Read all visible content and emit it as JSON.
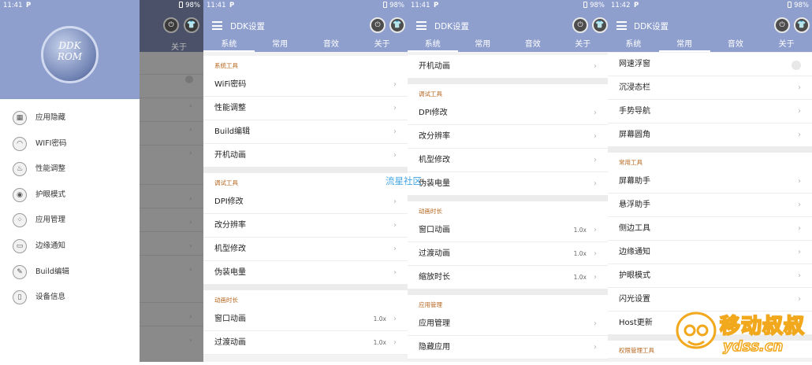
{
  "screens": [
    {
      "status": {
        "time": "11:41",
        "icon": "P",
        "battery": "98%"
      }
    },
    {
      "status": {
        "time": "11:41",
        "icon": "P",
        "battery": "98%"
      }
    },
    {
      "status": {
        "time": "11:41",
        "icon": "P",
        "battery": "98%"
      }
    },
    {
      "status": {
        "time": "11:42",
        "icon": "P",
        "battery": "98%"
      }
    }
  ],
  "app": {
    "title": "DDK设置"
  },
  "tabs": [
    "系统",
    "常用",
    "音效",
    "关于"
  ],
  "drawer": {
    "logo_lines": [
      "DDK",
      "ROM"
    ],
    "items": [
      {
        "label": "应用隐藏",
        "icon": "app-grid-icon"
      },
      {
        "label": "WIFI密码",
        "icon": "wifi-icon"
      },
      {
        "label": "性能调整",
        "icon": "flame-icon"
      },
      {
        "label": "护眼模式",
        "icon": "eye-icon"
      },
      {
        "label": "应用管理",
        "icon": "apps-icon"
      },
      {
        "label": "边缘通知",
        "icon": "edge-icon"
      },
      {
        "label": "Build编辑",
        "icon": "edit-icon"
      },
      {
        "label": "设备信息",
        "icon": "phone-icon"
      }
    ],
    "scrim_tab": "关于"
  },
  "screen2": {
    "sections": [
      {
        "title": "系统工具",
        "rows": [
          {
            "label": "WiFi密码"
          },
          {
            "label": "性能调整"
          },
          {
            "label": "Build编辑"
          },
          {
            "label": "开机动画"
          }
        ]
      },
      {
        "title": "调试工具",
        "rows": [
          {
            "label": "DPI修改"
          },
          {
            "label": "改分辨率"
          },
          {
            "label": "机型修改"
          },
          {
            "label": "伪装电量"
          }
        ]
      },
      {
        "title": "动画时长",
        "rows": [
          {
            "label": "窗口动画",
            "value": "1.0x"
          },
          {
            "label": "过渡动画",
            "value": "1.0x"
          }
        ]
      }
    ]
  },
  "screen3": {
    "top_row": {
      "label": "开机动画"
    },
    "sections": [
      {
        "title": "调试工具",
        "rows": [
          {
            "label": "DPI修改"
          },
          {
            "label": "改分辨率"
          },
          {
            "label": "机型修改"
          },
          {
            "label": "伪装电量"
          }
        ]
      },
      {
        "title": "动画时长",
        "rows": [
          {
            "label": "窗口动画",
            "value": "1.0x"
          },
          {
            "label": "过渡动画",
            "value": "1.0x"
          },
          {
            "label": "缩放时长",
            "value": "1.0x"
          }
        ]
      },
      {
        "title": "应用管理",
        "rows": [
          {
            "label": "应用管理"
          },
          {
            "label": "隐藏应用"
          }
        ]
      }
    ]
  },
  "screen4": {
    "top_rows": [
      {
        "label": "网速浮窗",
        "toggle": true
      },
      {
        "label": "沉浸态栏"
      },
      {
        "label": "手势导航"
      },
      {
        "label": "屏幕圆角"
      }
    ],
    "sections": [
      {
        "title": "常用工具",
        "rows": [
          {
            "label": "屏幕助手"
          },
          {
            "label": "悬浮助手"
          },
          {
            "label": "侧边工具"
          },
          {
            "label": "边缘通知"
          },
          {
            "label": "护眼模式"
          },
          {
            "label": "闪光设置"
          },
          {
            "label": "Host更新"
          }
        ]
      },
      {
        "title": "权限管理工具",
        "rows": []
      }
    ]
  },
  "watermark": {
    "text": "流星社区",
    "site_brand": "ydss.cn",
    "site_logo": "移动叔叔"
  },
  "colors": {
    "header": "#8e9fce",
    "section_title": "#b5651d",
    "watermark": "#2d9be0",
    "brand_orange": "#f2a81d"
  }
}
